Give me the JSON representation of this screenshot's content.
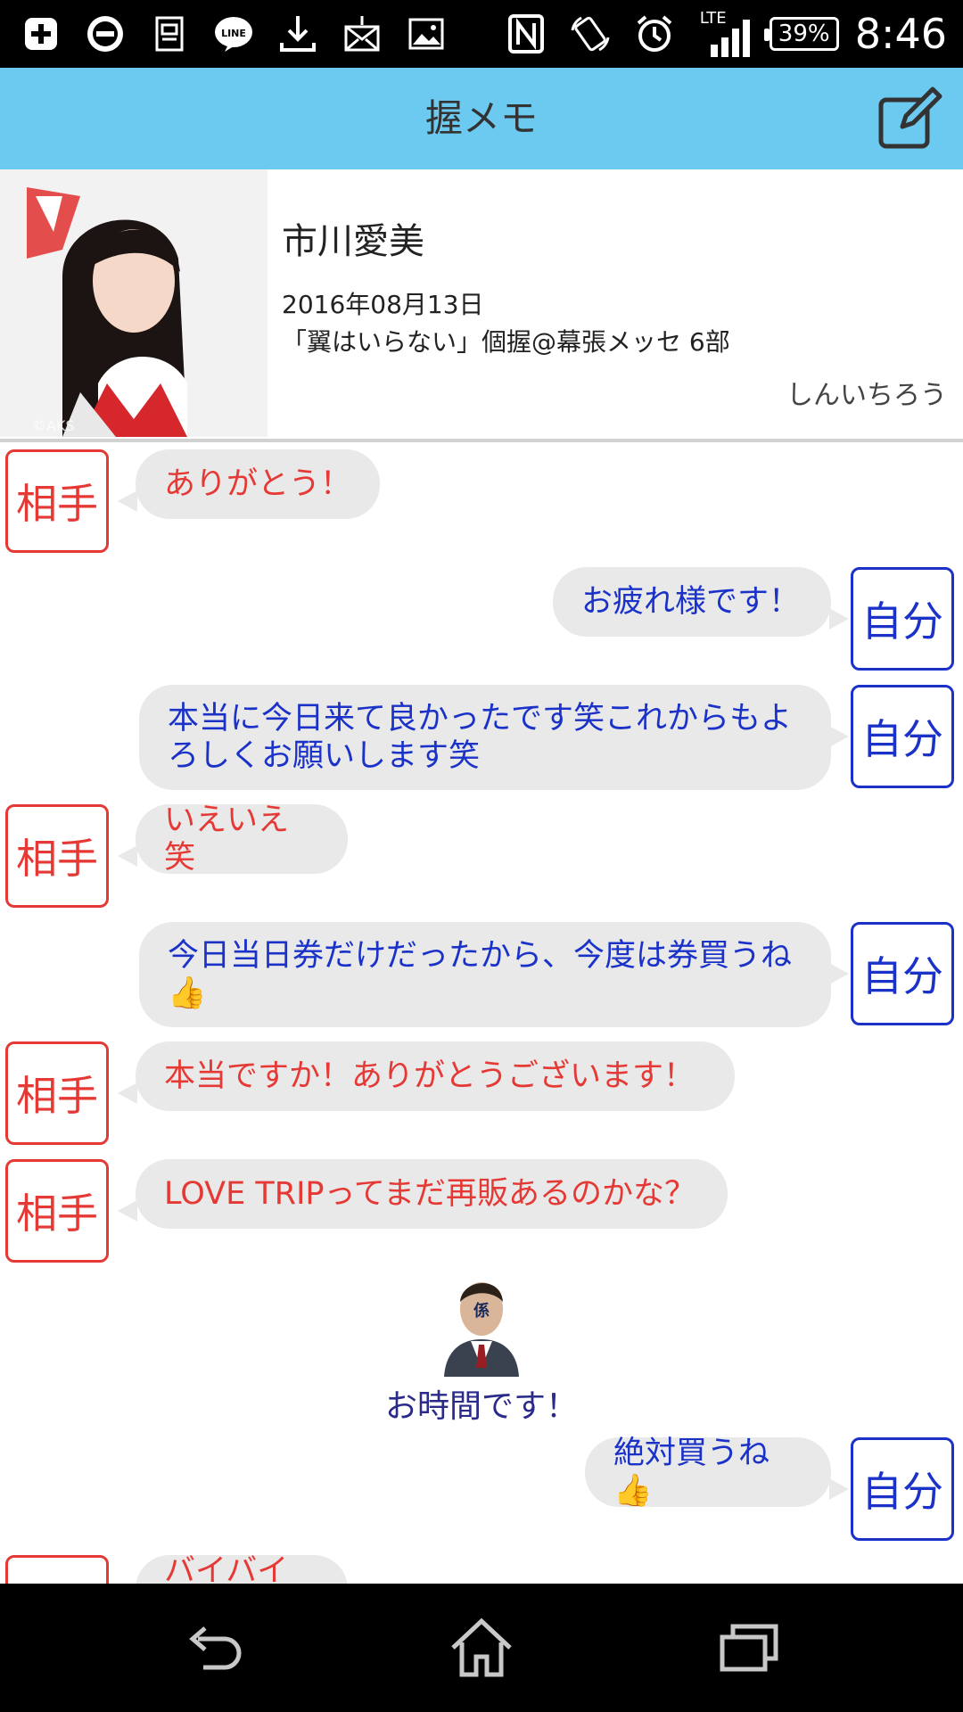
{
  "status_bar": {
    "icons": [
      "plus-icon",
      "showroom-icon",
      "copy-icon",
      "line-icon",
      "download-icon",
      "mail-icon",
      "image-icon",
      "nfc-icon",
      "rotate-icon",
      "alarm-icon",
      "signal-icon"
    ],
    "network": "LTE",
    "battery": "39%",
    "time": "8:46"
  },
  "header": {
    "title": "握メモ",
    "edit_icon": "edit-icon"
  },
  "profile": {
    "name": "市川愛美",
    "date": "2016年08月13日",
    "event": "「翼はいらない」個握@幕張メッセ 6部",
    "user": "しんいちろう",
    "photo_watermark": "©AKS"
  },
  "labels": {
    "other": "相手",
    "me": "自分"
  },
  "messages": [
    {
      "side": "other",
      "text": "ありがとう！"
    },
    {
      "side": "me",
      "text": "お疲れ様です！"
    },
    {
      "side": "me",
      "text": "本当に今日来て良かったです笑これからもよろしくお願いします笑"
    },
    {
      "side": "other",
      "text": "いえいえ笑"
    },
    {
      "side": "me",
      "text": "今日当日券だけだったから、今度は券買うね👍"
    },
    {
      "side": "other",
      "text": "本当ですか！ありがとうございます！"
    },
    {
      "side": "other",
      "text": "LOVE TRIPってまだ再販あるのかな？"
    },
    {
      "side": "me",
      "text": "絶対買うね👍"
    },
    {
      "side": "other",
      "text": "バイバイ👋"
    }
  ],
  "staff": {
    "avatar_label": "係",
    "text": "お時間です！"
  },
  "nav": {
    "back": "back-icon",
    "home": "home-icon",
    "recents": "recents-icon"
  },
  "colors": {
    "header": "#6ccaf1",
    "other": "#e53935",
    "me": "#1a32c8",
    "bubble": "#e9e9e9"
  }
}
